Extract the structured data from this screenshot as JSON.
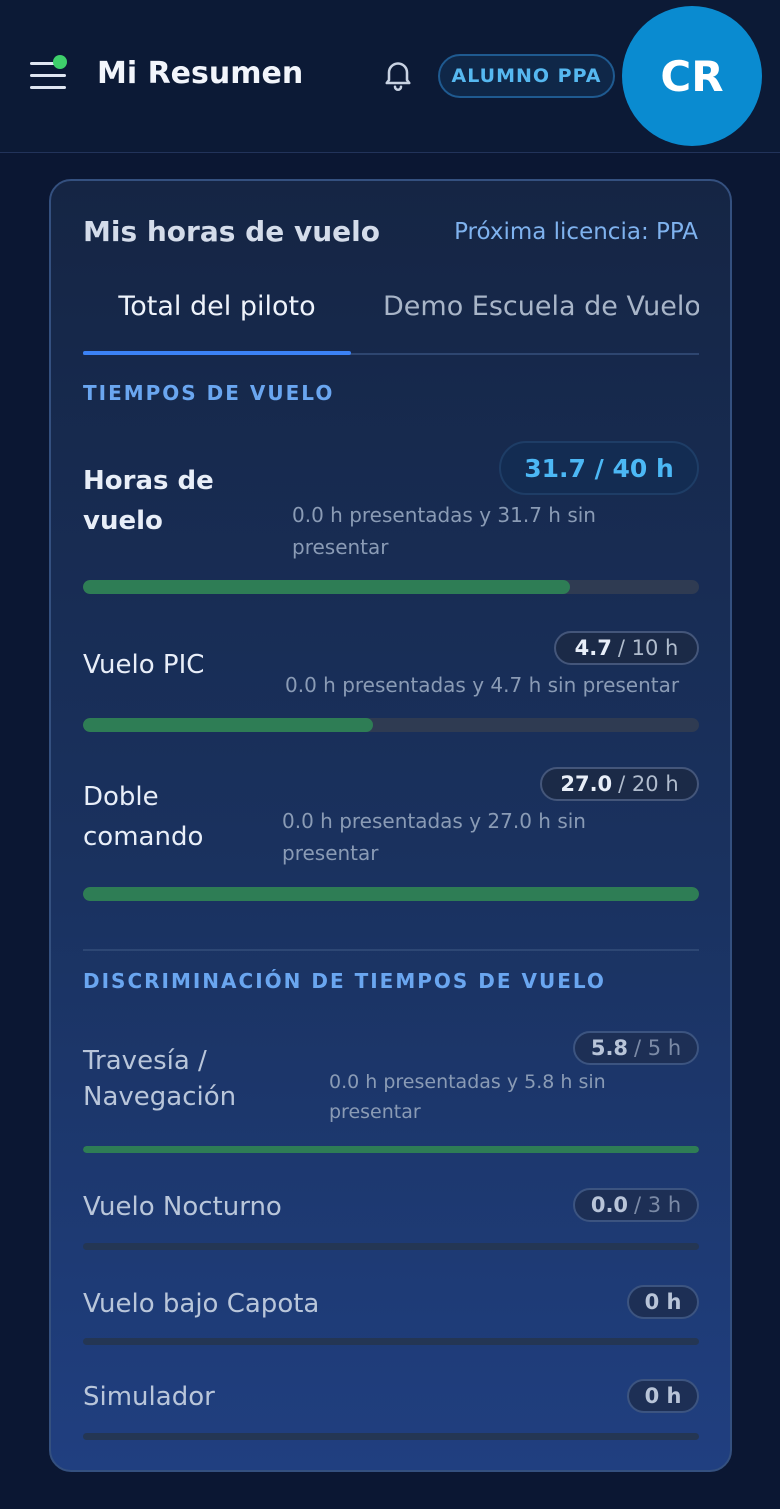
{
  "header": {
    "title": "Mi Resumen",
    "role_badge": "ALUMNO PPA",
    "avatar_initials": "CR"
  },
  "card": {
    "title": "Mis horas de vuelo",
    "next_license": "Próxima licencia: PPA",
    "tabs": [
      {
        "label": "Total del piloto",
        "active": true
      },
      {
        "label": "Demo Escuela de Vuelo",
        "active": false
      }
    ],
    "flight_times": {
      "section_title": "TIEMPOS DE VUELO",
      "items": [
        {
          "label": "Horas de vuelo",
          "value": "31.7 / 40 h",
          "detail": "0.0 h presentadas y 31.7 h sin presentar",
          "progress": 0.79
        },
        {
          "label": "Vuelo PIC",
          "value": "4.7",
          "target": "/ 10 h",
          "detail": "0.0 h presentadas y 4.7 h sin presentar",
          "progress": 0.47
        },
        {
          "label": "Doble comando",
          "value": "27.0",
          "target": "/ 20 h",
          "detail": "0.0 h presentadas y 27.0 h sin presentar",
          "progress": 1.0
        }
      ]
    },
    "breakdown": {
      "section_title": "DISCRIMINACIÓN DE TIEMPOS DE VUELO",
      "items": [
        {
          "label": "Travesía / Navegación",
          "value": "5.8",
          "target": "/ 5 h",
          "detail": "0.0 h presentadas y 5.8 h sin presentar",
          "progress": 1.0
        },
        {
          "label": "Vuelo Nocturno",
          "value": "0.0",
          "target": "/ 3 h",
          "progress": 0.0
        },
        {
          "label": "Vuelo bajo Capota",
          "value": "0 h",
          "progress": 0.0
        },
        {
          "label": "Simulador",
          "value": "0 h",
          "progress": 0.0
        }
      ]
    }
  },
  "colors": {
    "background": "#0b1733",
    "accent": "#3b82f6",
    "progress_fill": "#2e7d55",
    "avatar": "#0a8bd0",
    "online_dot": "#3ecf6b"
  }
}
